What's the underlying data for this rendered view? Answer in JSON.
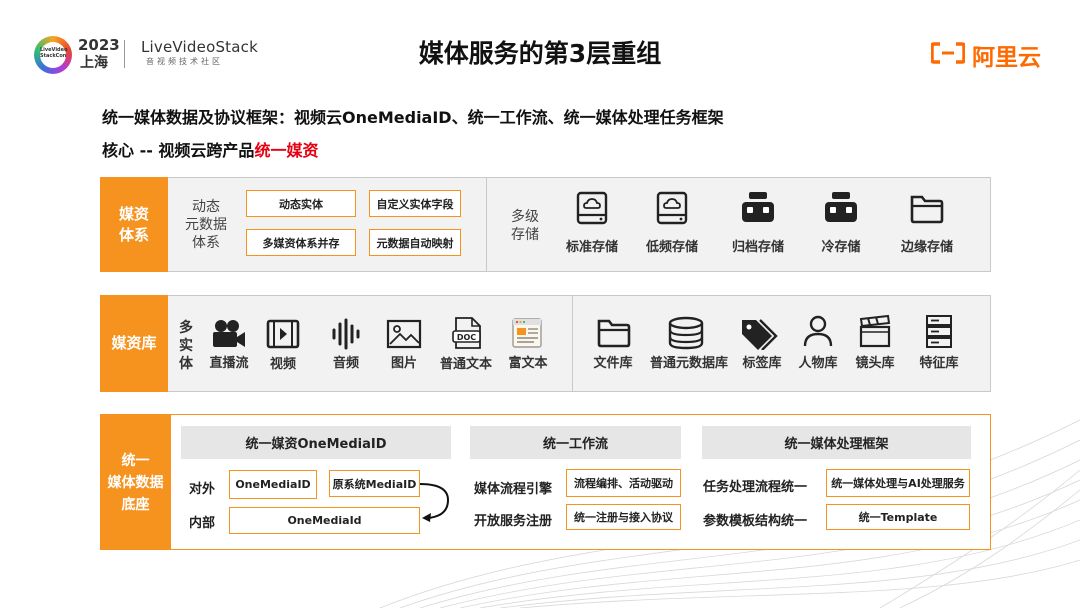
{
  "header": {
    "logo_year": "2023",
    "logo_city": "上海",
    "logo_badge": "LiveVideo StackCon",
    "brand": "LiveVideoStack",
    "brand_sub": "音视频技术社区",
    "title": "媒体服务的第3层重组",
    "aliyun": "阿里云"
  },
  "subtitle": {
    "line1": "统一媒体数据及协议框架：视频云OneMediaID、统一工作流、统一媒体处理任务框架",
    "line2_prefix": "核心 -- 视频云跨产品",
    "line2_highlight": "统一媒资"
  },
  "colors": {
    "accent": "#f6921e",
    "highlight": "#e60012",
    "brand": "#ff6a00"
  },
  "row1": {
    "label_a": "媒资",
    "label_b": "体系",
    "meta_label": [
      "动态",
      "元数据",
      "体系"
    ],
    "boxes": [
      "动态实体",
      "自定义实体字段",
      "多媒资体系并存",
      "元数据自动映射"
    ],
    "storage_label": [
      "多级",
      "存储"
    ],
    "storage_items": [
      {
        "icon": "cloud-drive-icon",
        "label": "标准存储"
      },
      {
        "icon": "cloud-drive-icon",
        "label": "低频存储"
      },
      {
        "icon": "archive-icon",
        "label": "归档存储"
      },
      {
        "icon": "archive-icon",
        "label": "冷存储"
      },
      {
        "icon": "folder-icon",
        "label": "边缘存储"
      }
    ]
  },
  "row2": {
    "label": "媒资库",
    "multi_label": [
      "多",
      "实",
      "体"
    ],
    "entities": [
      {
        "icon": "video-camera-icon",
        "label": "直播流"
      },
      {
        "icon": "film-icon",
        "label": "视频"
      },
      {
        "icon": "audio-wave-icon",
        "label": "音频"
      },
      {
        "icon": "image-icon",
        "label": "图片"
      },
      {
        "icon": "doc-icon",
        "label": "普通文本"
      },
      {
        "icon": "rich-text-icon",
        "label": "富文本"
      }
    ],
    "libraries": [
      {
        "icon": "folder-icon",
        "label": "文件库"
      },
      {
        "icon": "database-icon",
        "label": "普通元数据库"
      },
      {
        "icon": "tags-icon",
        "label": "标签库"
      },
      {
        "icon": "person-icon",
        "label": "人物库"
      },
      {
        "icon": "clapper-icon",
        "label": "镜头库"
      },
      {
        "icon": "server-icon",
        "label": "特征库"
      }
    ]
  },
  "row3": {
    "label_a": "统一",
    "label_b": "媒体数据",
    "label_c": "底座",
    "g1": {
      "header": "统一媒资OneMediaID",
      "row_out": "对外",
      "row_in": "内部",
      "box1": "OneMediaID",
      "box2": "原系统MediaID",
      "box3": "OneMediaId"
    },
    "g2": {
      "header": "统一工作流",
      "r1_label": "媒体流程引擎",
      "r1_box": "流程编排、活动驱动",
      "r2_label": "开放服务注册",
      "r2_box": "统一注册与接入协议"
    },
    "g3": {
      "header": "统一媒体处理框架",
      "r1_label": "任务处理流程统一",
      "r1_box": "统一媒体处理与AI处理服务",
      "r2_label": "参数模板结构统一",
      "r2_box": "统一Template"
    }
  }
}
